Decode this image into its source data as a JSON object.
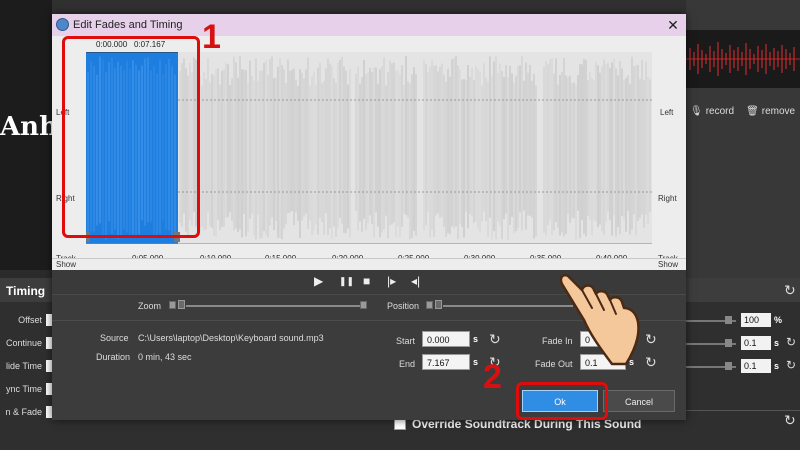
{
  "background": {
    "partial_word": "Anh",
    "record_label": "record",
    "remove_label": "remove",
    "panel_title": "Timing",
    "labels": [
      "Offset",
      "Continue",
      "lide Time",
      "ync Time",
      "n & Fade"
    ],
    "fields": [
      "100",
      "0.1",
      "0.1"
    ],
    "units": [
      "%",
      "s",
      "s"
    ],
    "override_label": "Override Soundtrack During This Sound"
  },
  "dialog": {
    "title": "Edit Fades and Timing",
    "close_glyph": "✕",
    "waveform": {
      "selection_start": "0:00.000",
      "selection_end": "0:07.167",
      "channel_left": "Left",
      "channel_right": "Right",
      "track_label": "Track",
      "show_label": "Show",
      "ticks": [
        "0:05.000",
        "0:10.000",
        "0:15.000",
        "0:20.000",
        "0:25.000",
        "0:30.000",
        "0:35.000",
        "0:40.000"
      ]
    },
    "transport": {
      "play": "▶",
      "pause": "❚❚",
      "stop": "■",
      "jump_end": "|▸",
      "jump_start": "◂|"
    },
    "zoom_label": "Zoom",
    "position_label": "Position",
    "source_label": "Source",
    "source_value": "C:\\Users\\laptop\\Desktop\\Keyboard sound.mp3",
    "duration_label": "Duration",
    "duration_value": "0 min, 43 sec",
    "start_label": "Start",
    "start_value": "0.000",
    "end_label": "End",
    "end_value": "7.167",
    "fade_in_label": "Fade In",
    "fade_in_value": "0",
    "fade_out_label": "Fade Out",
    "fade_out_value": "0.1",
    "unit": "s",
    "ok_label": "Ok",
    "cancel_label": "Cancel"
  },
  "annotations": {
    "step1": "1",
    "step2": "2"
  },
  "colors": {
    "selection": "#1e7ee0",
    "annotation": "#e00b0b",
    "ok_button": "#2f8de4",
    "titlebar": "#e7d1ea"
  }
}
